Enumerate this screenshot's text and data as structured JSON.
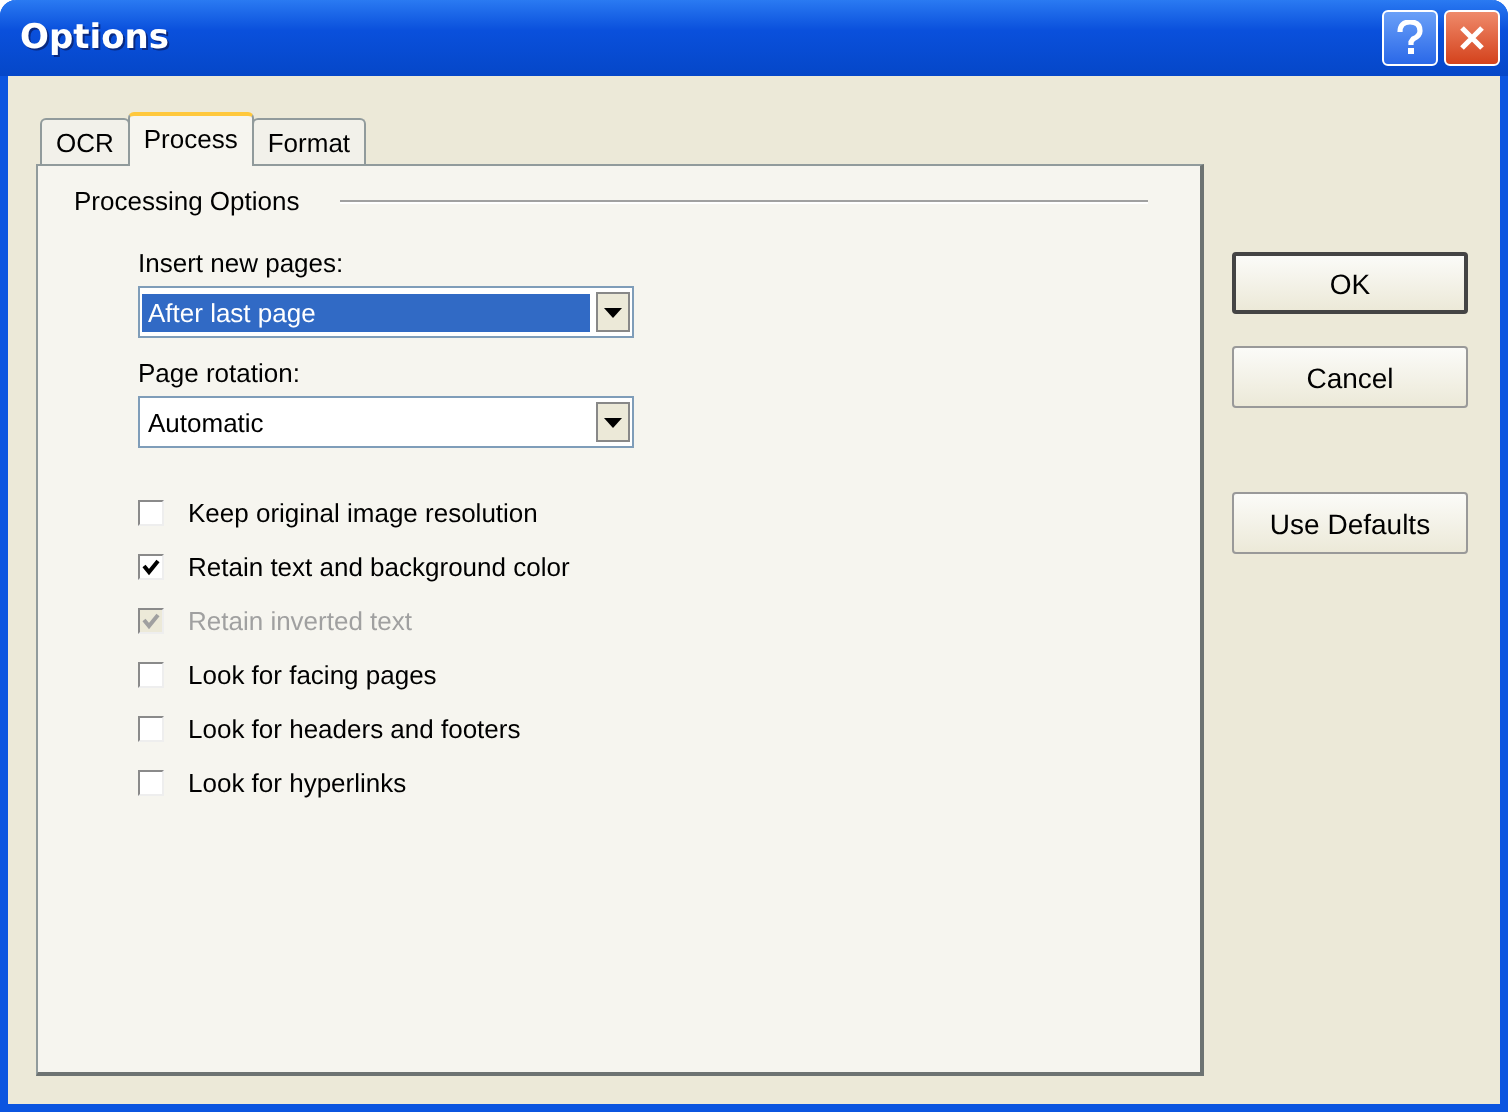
{
  "window": {
    "title": "Options"
  },
  "tabs": [
    {
      "label": "OCR",
      "selected": false
    },
    {
      "label": "Process",
      "selected": true
    },
    {
      "label": "Format",
      "selected": false
    }
  ],
  "group": {
    "title": "Processing Options"
  },
  "dropdowns": [
    {
      "label": "Insert new pages:",
      "value": "After last page",
      "focused": true
    },
    {
      "label": "Page rotation:",
      "value": "Automatic",
      "focused": false
    }
  ],
  "checkboxes": [
    {
      "label": "Keep original image resolution",
      "checked": false,
      "disabled": false
    },
    {
      "label": "Retain text and background color",
      "checked": true,
      "disabled": false
    },
    {
      "label": "Retain inverted text",
      "checked": true,
      "disabled": true
    },
    {
      "label": "Look for facing pages",
      "checked": false,
      "disabled": false
    },
    {
      "label": "Look for headers and footers",
      "checked": false,
      "disabled": false
    },
    {
      "label": "Look for hyperlinks",
      "checked": false,
      "disabled": false
    }
  ],
  "buttons": [
    {
      "label": "OK",
      "default": true
    },
    {
      "label": "Cancel",
      "default": false
    },
    {
      "label": "Use Defaults",
      "default": false
    }
  ]
}
